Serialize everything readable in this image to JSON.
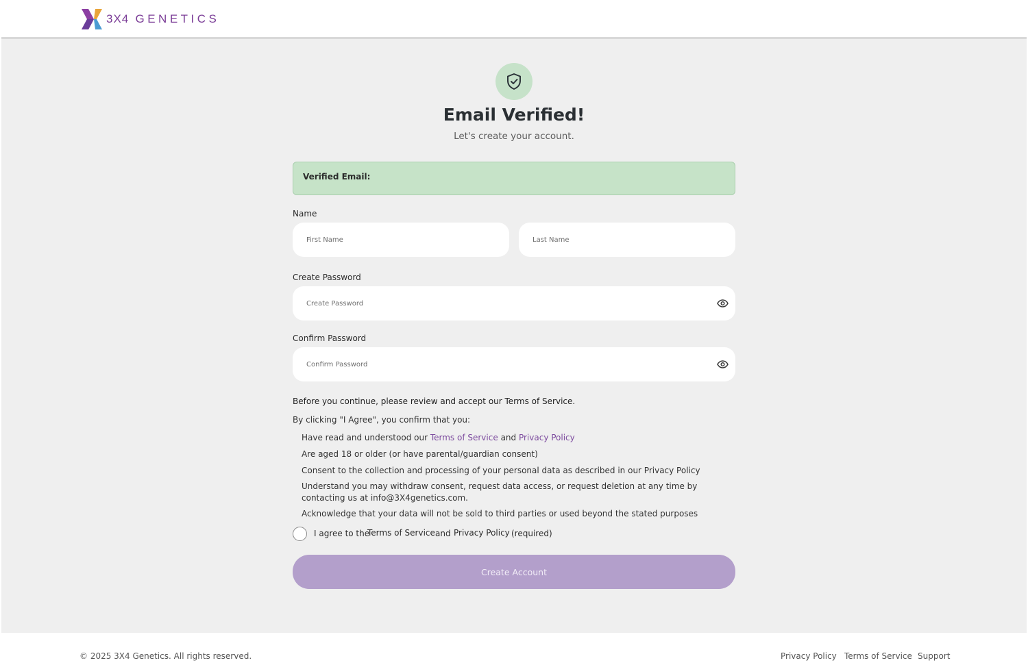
{
  "header": {
    "logo_text": "3X4 GENETICS",
    "logo_number": "3X4",
    "logo_word": "GENETICS"
  },
  "hero": {
    "icon": "shield-check-icon",
    "title": "Email Verified!",
    "subtitle": "Let's create your account."
  },
  "verified_email": {
    "label": "Verified Email:",
    "value": ""
  },
  "name": {
    "label": "Name",
    "first_placeholder": "First Name",
    "last_placeholder": "Last Name",
    "first_value": "",
    "last_value": ""
  },
  "create_password": {
    "label": "Create Password",
    "placeholder": "Create Password",
    "toggle_icon": "eye-icon"
  },
  "confirm_password": {
    "label": "Confirm Password",
    "placeholder": "Confirm Password",
    "toggle_icon": "eye-icon"
  },
  "terms": {
    "heading": "Before you continue, please review and accept our Terms of Service.",
    "intro": "By clicking \"I Agree\", you confirm that you:",
    "bullet1_prefix": "Have read and understood our",
    "bullet1_link1": "Terms of Service",
    "bullet1_and": "and",
    "bullet1_link2": "Privacy Policy",
    "bullet2": "Are aged 18 or older (or have parental/guardian consent)",
    "bullet3": "Consent to the collection and processing of your personal data as described in our Privacy Policy",
    "bullet4": "Understand you may withdraw consent, request data access, or request deletion at any time by contacting us at info@3X4genetics.com.",
    "bullet5": "Acknowledge that your data will not be sold to third parties or used beyond the stated purposes"
  },
  "agree": {
    "prefix": "I agree to the",
    "link1": "Terms of Service",
    "and": "and",
    "link2": "Privacy Policy",
    "suffix": "(required)",
    "checked": false
  },
  "submit": {
    "label": "Create Account"
  },
  "footer": {
    "copyright": "© 2025 3X4 Genetics. All rights reserved.",
    "links": [
      "Privacy Policy",
      "Terms of Service",
      "Support"
    ]
  },
  "colors": {
    "brand_purple": "#7b3d97",
    "success_green": "#c6e3c8",
    "button_purple": "#b39fcb",
    "page_background": "#efefef"
  }
}
